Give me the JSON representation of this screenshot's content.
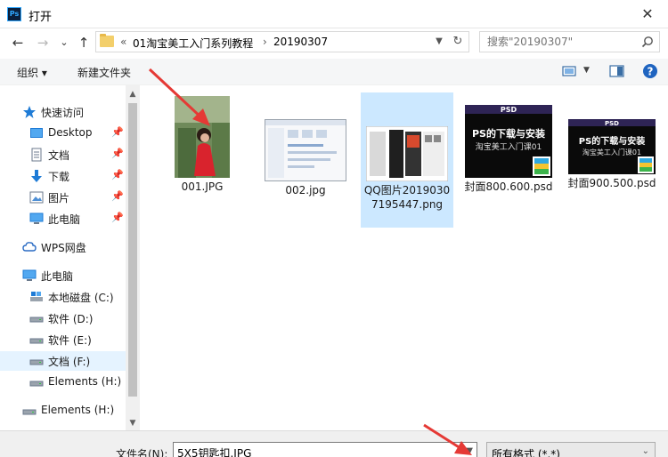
{
  "window": {
    "title": "打开",
    "app_icon": "Ps",
    "close_glyph": "✕"
  },
  "nav": {
    "back": "←",
    "forward": "→",
    "recent": "⌄",
    "up": "↑"
  },
  "address": {
    "prefix": "«",
    "crumbs": [
      "01淘宝美工入门系列教程",
      "20190307"
    ],
    "separator": "›"
  },
  "search": {
    "placeholder": "搜索\"20190307\""
  },
  "toolbar": {
    "organize": "组织 ▾",
    "new_folder": "新建文件夹",
    "help": "?"
  },
  "sidebar": {
    "items": [
      {
        "label": "快速访问",
        "icon": "star-icon"
      },
      {
        "label": "Desktop",
        "icon": "desktop-icon",
        "pinned": true
      },
      {
        "label": "文档",
        "icon": "document-icon",
        "pinned": true
      },
      {
        "label": "下载",
        "icon": "download-icon",
        "pinned": true
      },
      {
        "label": "图片",
        "icon": "picture-icon",
        "pinned": true
      },
      {
        "label": "此电脑",
        "icon": "computer-icon",
        "pinned": true
      },
      {
        "label": "WPS网盘",
        "icon": "cloud-icon"
      },
      {
        "label": "此电脑",
        "icon": "computer-icon"
      },
      {
        "label": "本地磁盘 (C:)",
        "icon": "drive-c-icon"
      },
      {
        "label": "软件 (D:)",
        "icon": "drive-icon"
      },
      {
        "label": "软件 (E:)",
        "icon": "drive-icon"
      },
      {
        "label": "文档 (F:)",
        "icon": "drive-icon",
        "selected": true
      },
      {
        "label": "Elements (H:)",
        "icon": "drive-icon"
      },
      {
        "label": "Elements (H:)",
        "icon": "drive-icon"
      }
    ]
  },
  "files": [
    {
      "name": "001.JPG",
      "type": "photo"
    },
    {
      "name": "002.jpg",
      "type": "screenshot"
    },
    {
      "name": "QQ图片20190307195447.png",
      "type": "screenshot-dark",
      "selected": true
    },
    {
      "name": "封面800.600.psd",
      "type": "psd",
      "badge": "PSD",
      "line1": "PS的下载与安装",
      "line2": "淘宝美工入门课01"
    },
    {
      "name": "封面900.500.psd",
      "type": "psd",
      "badge": "PSD",
      "line1": "PS的下载与安装",
      "line2": "淘宝美工入门课01"
    }
  ],
  "footer": {
    "filename_label": "文件名(N):",
    "filename_value": "5X5钥匙扣.JPG",
    "filetype_value": "所有格式 (*.*)"
  },
  "colors": {
    "accent": "#0078d7",
    "selected_bg": "#cce8ff",
    "annotation": "#e53935"
  }
}
